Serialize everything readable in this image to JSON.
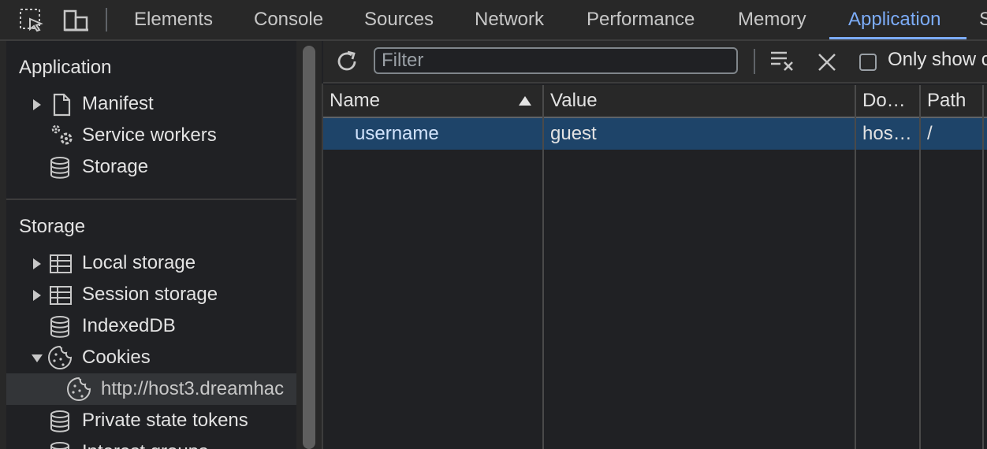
{
  "toolbar": {
    "tabs": [
      {
        "label": "Elements"
      },
      {
        "label": "Console"
      },
      {
        "label": "Sources"
      },
      {
        "label": "Network"
      },
      {
        "label": "Performance"
      },
      {
        "label": "Memory"
      },
      {
        "label": "Application",
        "active": true
      },
      {
        "label": "S"
      }
    ],
    "accent_color": "#7cacf8"
  },
  "sidebar": {
    "application_section": {
      "title": "Application",
      "items": [
        {
          "label": "Manifest",
          "icon": "document-icon",
          "expandable": true
        },
        {
          "label": "Service workers",
          "icon": "gears-icon"
        },
        {
          "label": "Storage",
          "icon": "database-icon"
        }
      ]
    },
    "storage_section": {
      "title": "Storage",
      "items": [
        {
          "label": "Local storage",
          "icon": "table-icon",
          "expandable": true
        },
        {
          "label": "Session storage",
          "icon": "table-icon",
          "expandable": true
        },
        {
          "label": "IndexedDB",
          "icon": "database-icon"
        },
        {
          "label": "Cookies",
          "icon": "cookie-icon",
          "expanded": true
        },
        {
          "label": "http://host3.dreamhac",
          "icon": "cookie-icon",
          "selected": true
        },
        {
          "label": "Private state tokens",
          "icon": "database-icon"
        },
        {
          "label": "Interest groups",
          "icon": "database-icon"
        }
      ]
    }
  },
  "filter": {
    "placeholder": "Filter",
    "only_show_label": "Only show c"
  },
  "table": {
    "columns": [
      "Name",
      "Value",
      "Do…",
      "Path"
    ],
    "sort_column": "Name",
    "sort_direction": "ascending",
    "rows": [
      {
        "name": "username",
        "value": "guest",
        "domain": "hos…",
        "path": "/"
      }
    ],
    "selected_row_color": "#1e4469"
  }
}
